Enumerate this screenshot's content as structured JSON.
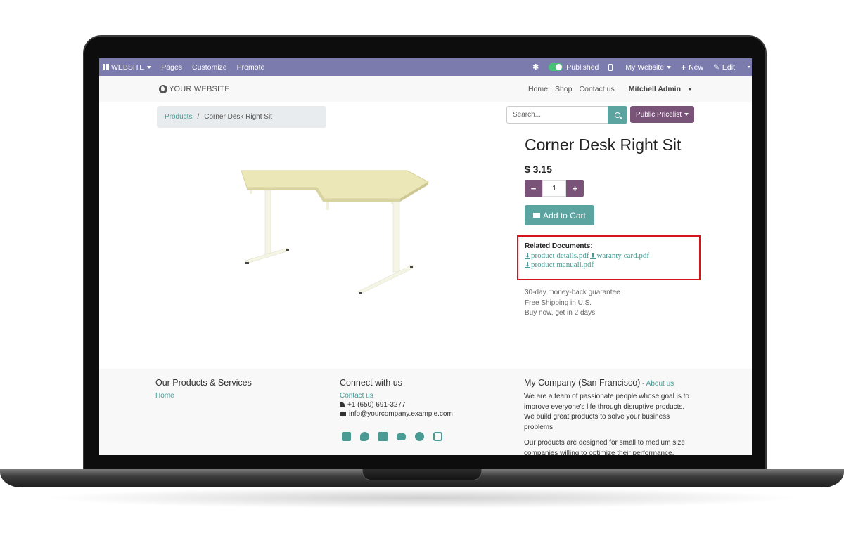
{
  "admin_bar": {
    "website_label": "WEBSITE",
    "pages_label": "Pages",
    "customize_label": "Customize",
    "promote_label": "Promote",
    "published_label": "Published",
    "my_website_label": "My Website",
    "new_label": "New",
    "edit_label": "Edit"
  },
  "header": {
    "logo_text": "YOUR WEBSITE",
    "nav": [
      "Home",
      "Shop",
      "Contact us"
    ],
    "user": "Mitchell Admin"
  },
  "breadcrumb": {
    "parent": "Products",
    "separator": "/",
    "current": "Corner Desk Right Sit"
  },
  "search": {
    "placeholder": "Search..."
  },
  "pricelist": {
    "label": "Public Pricelist"
  },
  "product": {
    "name": "Corner Desk Right Sit",
    "price": "$ 3.15",
    "quantity": "1",
    "minus_label": "−",
    "plus_label": "+",
    "add_to_cart_label": "Add to Cart",
    "related_docs_label": "Related Documents:",
    "documents": [
      "product details.pdf",
      "waranty card.pdf",
      "product manuall.pdf"
    ],
    "guarantees": [
      "30-day money-back guarantee",
      "Free Shipping in U.S.",
      "Buy now, get in 2 days"
    ]
  },
  "footer": {
    "col1": {
      "title": "Our Products & Services",
      "link": "Home"
    },
    "col2": {
      "title": "Connect with us",
      "contact_link": "Contact us",
      "phone": "+1 (650) 691-3277",
      "email": "info@yourcompany.example.com"
    },
    "col3": {
      "title": "My Company (San Francisco)",
      "title_sep": " - ",
      "about_link": "About us",
      "para1": "We are a team of passionate people whose goal is to improve everyone's life through disruptive products. We build great products to solve your business problems.",
      "para2": "Our products are designed for small to medium size companies willing to optimize their performance."
    },
    "social_icons": [
      "facebook-icon",
      "twitter-icon",
      "linkedin-icon",
      "youtube-icon",
      "github-icon",
      "instagram-icon"
    ]
  },
  "colors": {
    "admin_bar": "#7c7bad",
    "teal": "#5ba4a0",
    "link": "#4a9b94",
    "purple_button": "#7a5379",
    "highlight_border": "#d4151c"
  }
}
